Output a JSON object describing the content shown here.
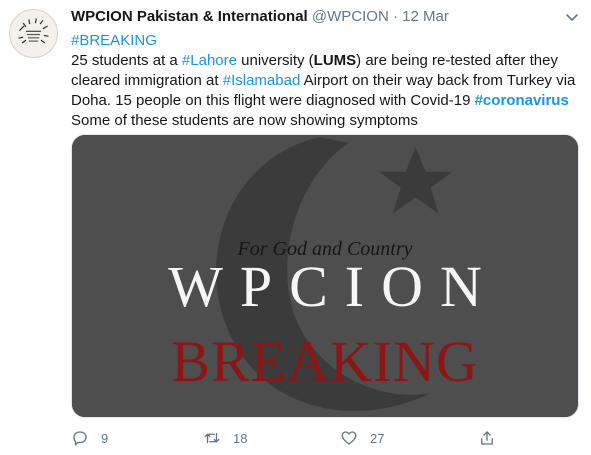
{
  "tweet": {
    "author_name": "WPCION Pakistan & International",
    "handle": "@WPCION",
    "separator": "·",
    "date": "12 Mar",
    "line1_hashtag": "#BREAKING",
    "text_part1": "25 students at a ",
    "hashtag_lahore": "#Lahore",
    "text_part2": " university (",
    "lums": "LUMS",
    "text_part3": ") are being re-tested after they cleared immigration at ",
    "hashtag_islamabad": "#Islamabad",
    "text_part4": " Airport on their way back from Turkey via Doha. 15 people on this flight were diagnosed with Covid-19 ",
    "hashtag_coronavirus": "#coronavirus",
    "text_part5": "Some of these students are now showing symptoms"
  },
  "media": {
    "motto": "For God and Country",
    "wordmark": "WPCION",
    "headline": "BREAKING",
    "background_color": "#4e4e4e",
    "crescent_color": "#3a3a3a",
    "headline_color": "#8c1515"
  },
  "actions": {
    "reply_count": "9",
    "retweet_count": "18",
    "like_count": "27"
  },
  "colors": {
    "link": "#1b95e0",
    "muted": "#657786"
  }
}
